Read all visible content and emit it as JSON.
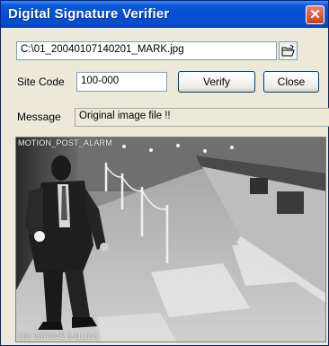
{
  "window": {
    "title": "Digital Signature Verifier"
  },
  "file": {
    "path": "C:\\01_20040107140201_MARK.jpg"
  },
  "site": {
    "label": "Site Code",
    "value": "100-000"
  },
  "buttons": {
    "verify": "Verify",
    "close": "Close"
  },
  "message": {
    "label": "Message",
    "value": "Original image file !!"
  },
  "video": {
    "overlay_top": "MOTION_POST_ALARM",
    "overlay_bottom": "C03 2007/04/2 5-01:18:3"
  },
  "colors": {
    "titlebar": "#0550D4",
    "window_bg": "#ECE9D8",
    "close_button": "#D9532D"
  },
  "icons": {
    "browse": "folder-open-icon",
    "close": "close-icon"
  }
}
